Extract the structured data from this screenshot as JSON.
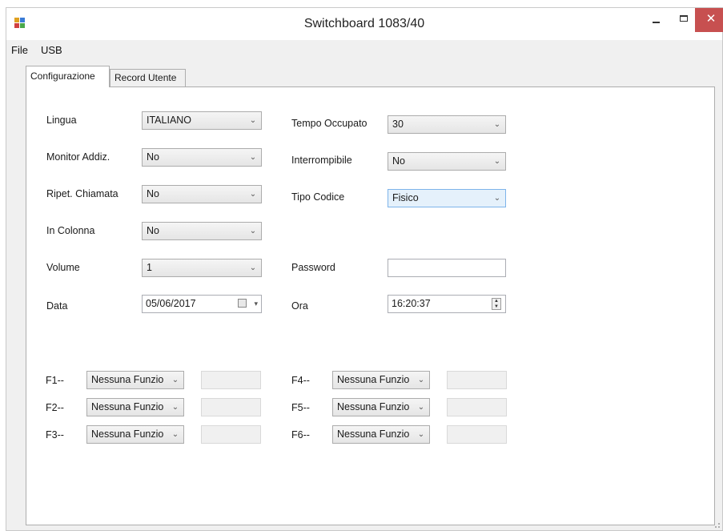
{
  "window": {
    "title": "Switchboard 1083/40",
    "close_glyph": "✕"
  },
  "menu": [
    "File",
    "USB"
  ],
  "tabs": [
    {
      "label": "Configurazione",
      "active": true
    },
    {
      "label": "Record Utente",
      "active": false
    }
  ],
  "fields": {
    "lingua": {
      "label": "Lingua",
      "value": "ITALIANO"
    },
    "monitor": {
      "label": "Monitor Addiz.",
      "value": "No"
    },
    "ripet": {
      "label": "Ripet. Chiamata",
      "value": "No"
    },
    "colonna": {
      "label": "In Colonna",
      "value": "No"
    },
    "volume": {
      "label": "Volume",
      "value": "1"
    },
    "data": {
      "label": "Data",
      "value": "05/06/2017"
    },
    "tempo": {
      "label": "Tempo Occupato",
      "value": "30"
    },
    "interrompibile": {
      "label": "Interrompibile",
      "value": "No"
    },
    "tipo_codice": {
      "label": "Tipo Codice",
      "value": "Fisico"
    },
    "password": {
      "label": "Password",
      "value": ""
    },
    "ora": {
      "label": "Ora",
      "value": "16:20:37"
    }
  },
  "function_keys": [
    {
      "label": "F1--",
      "value": "Nessuna Funzio"
    },
    {
      "label": "F2--",
      "value": "Nessuna Funzio"
    },
    {
      "label": "F3--",
      "value": "Nessuna Funzio"
    },
    {
      "label": "F4--",
      "value": "Nessuna Funzio"
    },
    {
      "label": "F5--",
      "value": "Nessuna Funzio"
    },
    {
      "label": "F6--",
      "value": "Nessuna Funzio"
    }
  ],
  "glyphs": {
    "dropdown": "⌄",
    "spin_up": "▲",
    "spin_down": "▼",
    "date_drop": "▾"
  },
  "colors": {
    "close": "#c75050",
    "highlight": "#e5f1fb",
    "highlight_border": "#7eb4ea"
  }
}
